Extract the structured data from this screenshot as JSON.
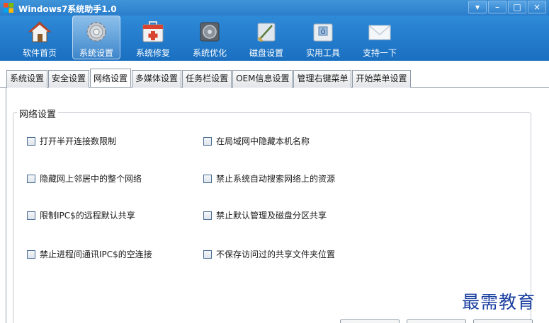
{
  "window": {
    "title": "Windows7系统助手1.0",
    "controls": [
      "▾",
      "–",
      "□",
      "×"
    ]
  },
  "toolbar": {
    "items": [
      {
        "label": "软件首页",
        "icon": "home-icon"
      },
      {
        "label": "系统设置",
        "icon": "gear-icon",
        "active": true
      },
      {
        "label": "系统修复",
        "icon": "first-aid-kit-icon"
      },
      {
        "label": "系统优化",
        "icon": "optimize-icon"
      },
      {
        "label": "磁盘设置",
        "icon": "disk-broom-icon"
      },
      {
        "label": "实用工具",
        "icon": "toolbox-icon"
      },
      {
        "label": "支持一下",
        "icon": "envelope-icon"
      }
    ]
  },
  "tabs": [
    {
      "label": "系统设置"
    },
    {
      "label": "安全设置"
    },
    {
      "label": "网络设置",
      "active": true
    },
    {
      "label": "多媒体设置"
    },
    {
      "label": "任务栏设置"
    },
    {
      "label": "OEM信息设置"
    },
    {
      "label": "管理右键菜单"
    },
    {
      "label": "开始菜单设置"
    }
  ],
  "group": {
    "title": "网络设置",
    "options": [
      {
        "label": "打开半开连接数限制",
        "checked": false
      },
      {
        "label": "在局域网中隐藏本机名称",
        "checked": false
      },
      {
        "label": "隐藏网上邻居中的整个网络",
        "checked": false
      },
      {
        "label": "禁止系统自动搜索网络上的资源",
        "checked": false
      },
      {
        "label": "限制IPC$的远程默认共享",
        "checked": false
      },
      {
        "label": "禁止默认管理及磁盘分区共享",
        "checked": false
      },
      {
        "label": "禁止进程间通讯IPC$的空连接",
        "checked": false
      },
      {
        "label": "不保存访问过的共享文件夹位置",
        "checked": false
      }
    ]
  },
  "watermark": "最需教育",
  "colors": {
    "titlebar": "#2b7ecb",
    "toolbar": "#1a6fc0",
    "watermark": "#1a3fa0"
  }
}
